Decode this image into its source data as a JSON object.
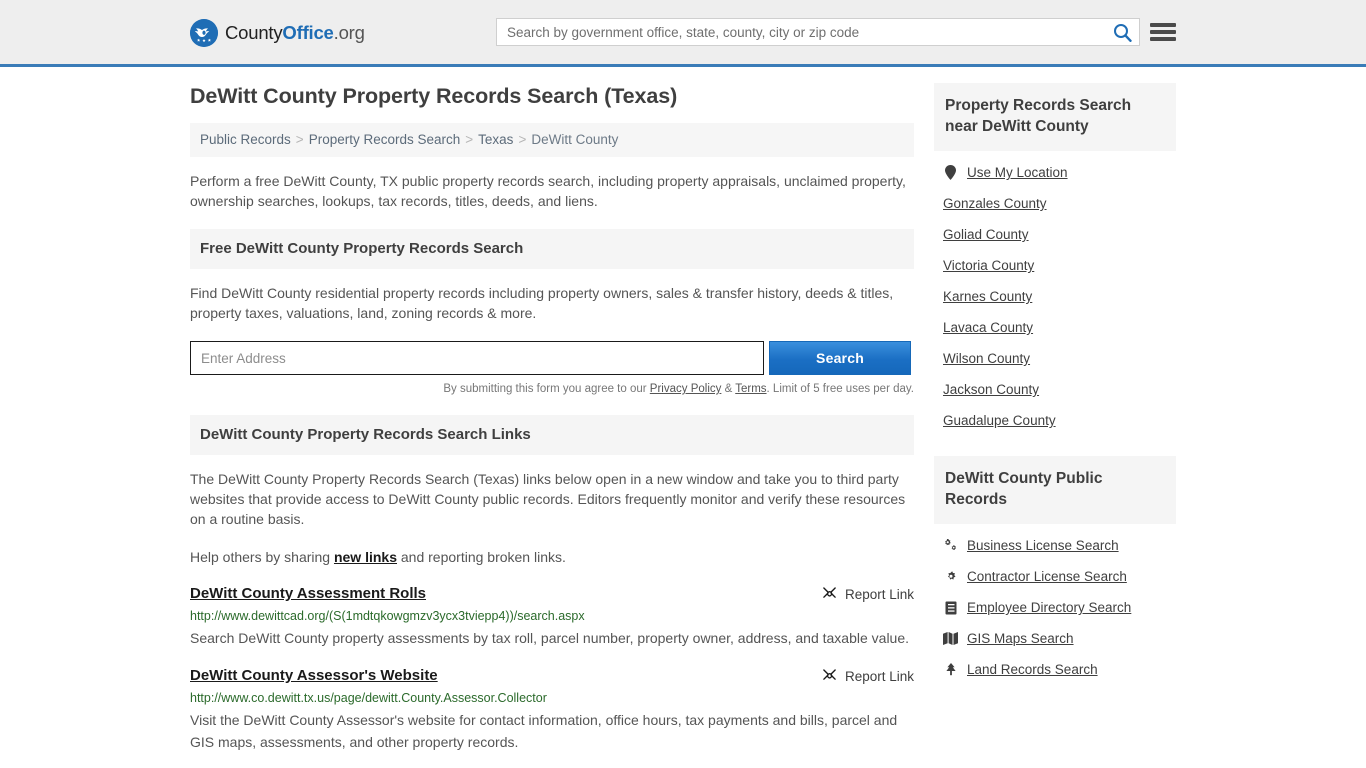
{
  "header": {
    "brand": {
      "part1": "County",
      "part2": "Office",
      "part3": ".org"
    },
    "search_placeholder": "Search by government office, state, county, city or zip code",
    "search_value": "",
    "search_icon": "search-icon",
    "menu_icon": "hamburger-menu-icon"
  },
  "main": {
    "title": "DeWitt County Property Records Search (Texas)",
    "breadcrumb": [
      "Public Records",
      "Property Records Search",
      "Texas",
      "DeWitt County"
    ],
    "breadcrumb_separator": ">",
    "intro": "Perform a free DeWitt County, TX public property records search, including property appraisals, unclaimed property, ownership searches, lookups, tax records, titles, deeds, and liens.",
    "search_section": {
      "heading": "Free DeWitt County Property Records Search",
      "description": "Find DeWitt County residential property records including property owners, sales & transfer history, deeds & titles, property taxes, valuations, land, zoning records & more.",
      "input_placeholder": "Enter Address",
      "input_value": "",
      "button_label": "Search",
      "disclaimer_prefix": "By submitting this form you agree to our ",
      "privacy_label": "Privacy Policy",
      "disclaimer_amp": " & ",
      "terms_label": "Terms",
      "disclaimer_suffix": ". Limit of 5 free uses per day."
    },
    "links_section": {
      "heading": "DeWitt County Property Records Search Links",
      "paragraph": "The DeWitt County Property Records Search (Texas) links below open in a new window and take you to third party websites that provide access to DeWitt County public records. Editors frequently monitor and verify these resources on a routine basis.",
      "help_prefix": "Help others by sharing ",
      "help_link": "new links",
      "help_suffix": " and reporting broken links.",
      "report_label": "Report Link",
      "report_icon": "broken-link-icon",
      "items": [
        {
          "title": "DeWitt County Assessment Rolls",
          "url": "http://www.dewittcad.org/(S(1mdtqkowgmzv3ycx3tviepp4))/search.aspx",
          "description": "Search DeWitt County property assessments by tax roll, parcel number, property owner, address, and taxable value."
        },
        {
          "title": "DeWitt County Assessor's Website",
          "url": "http://www.co.dewitt.tx.us/page/dewitt.County.Assessor.Collector",
          "description": "Visit the DeWitt County Assessor's website for contact information, office hours, tax payments and bills, parcel and GIS maps, assessments, and other property records."
        }
      ]
    }
  },
  "sidebar": {
    "nearby": {
      "heading": "Property Records Search near DeWitt County",
      "items": [
        {
          "label": "Use My Location",
          "icon": "map-pin-icon"
        },
        {
          "label": "Gonzales County",
          "icon": ""
        },
        {
          "label": "Goliad County",
          "icon": ""
        },
        {
          "label": "Victoria County",
          "icon": ""
        },
        {
          "label": "Karnes County",
          "icon": ""
        },
        {
          "label": "Lavaca County",
          "icon": ""
        },
        {
          "label": "Wilson County",
          "icon": ""
        },
        {
          "label": "Jackson County",
          "icon": ""
        },
        {
          "label": "Guadalupe County",
          "icon": ""
        }
      ]
    },
    "public_records": {
      "heading": "DeWitt County Public Records",
      "items": [
        {
          "label": "Business License Search",
          "icon": "cogs-icon"
        },
        {
          "label": "Contractor License Search",
          "icon": "cog-icon"
        },
        {
          "label": "Employee Directory Search",
          "icon": "id-card-icon"
        },
        {
          "label": "GIS Maps Search",
          "icon": "map-icon"
        },
        {
          "label": "Land Records Search",
          "icon": "tree-icon"
        }
      ]
    }
  },
  "colors": {
    "brand_blue": "#1f6db5",
    "header_rule": "#3a7cb8",
    "button_blue": "#1b6fc4",
    "url_green": "#2b6a2b",
    "section_bg": "#f5f5f5"
  }
}
